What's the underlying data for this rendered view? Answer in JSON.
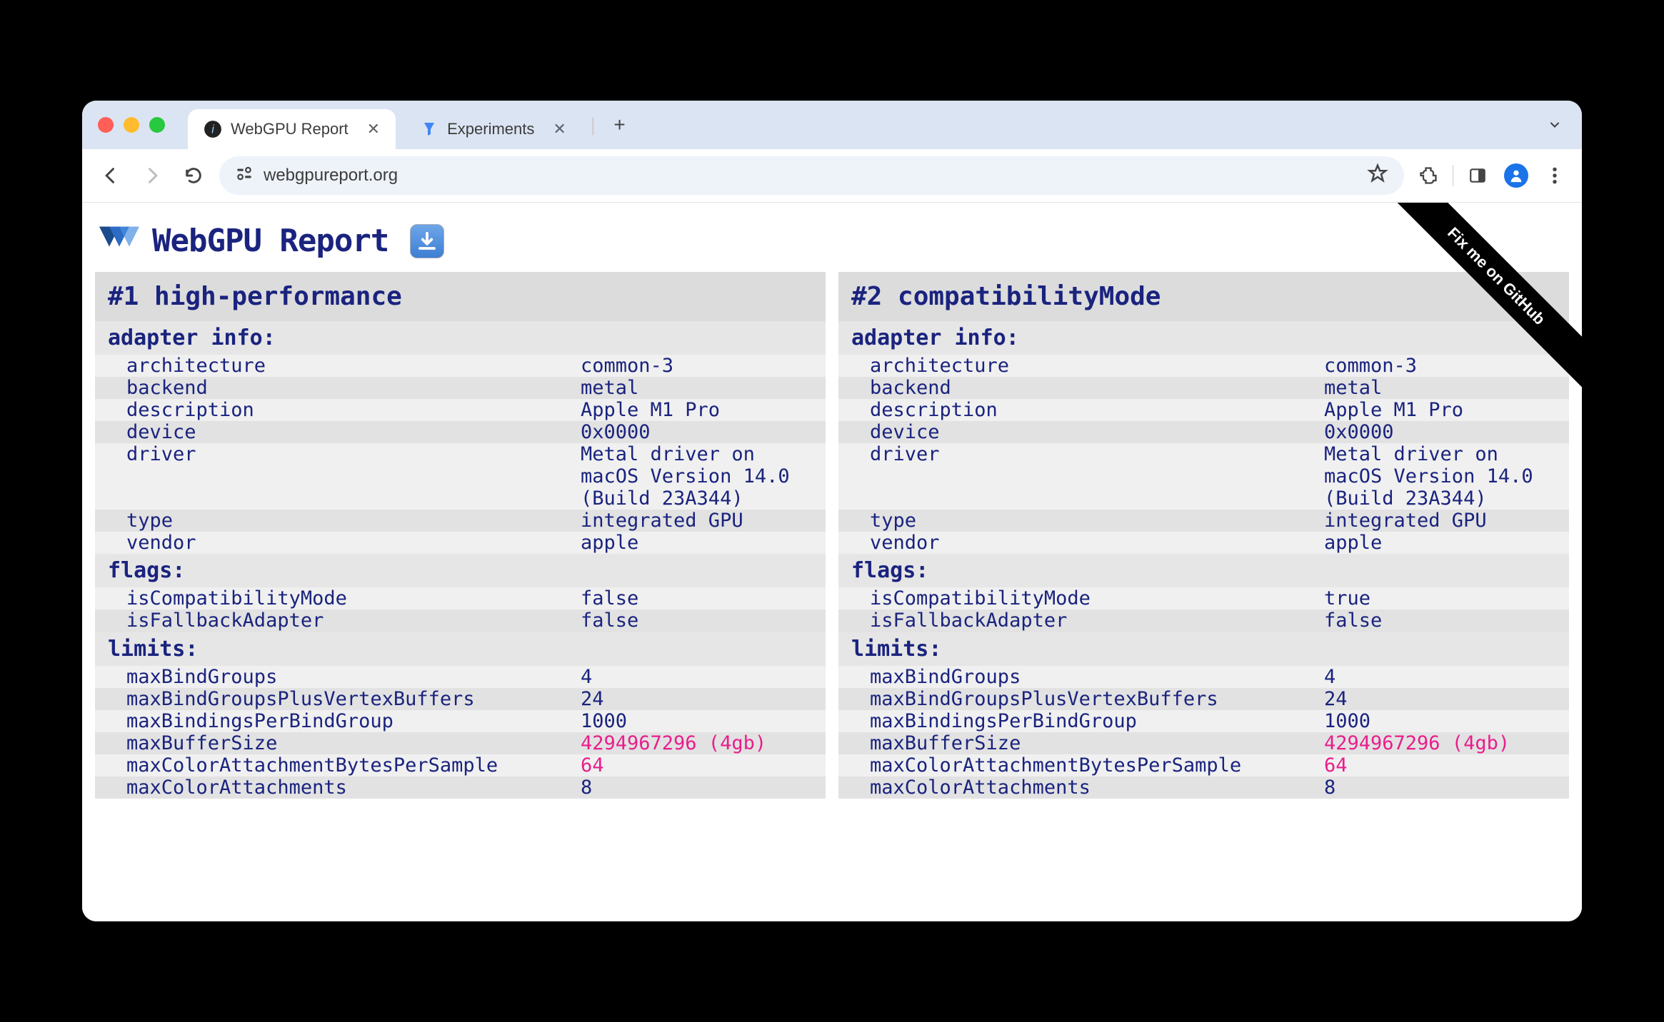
{
  "browser": {
    "tabs": [
      {
        "title": "WebGPU Report",
        "active": true
      },
      {
        "title": "Experiments",
        "active": false
      }
    ],
    "url": "webgpureport.org"
  },
  "page": {
    "title": "WebGPU Report",
    "ribbon": "Fix me on GitHub"
  },
  "adapters": [
    {
      "header": "#1 high-performance",
      "sections": [
        {
          "title": "adapter info:",
          "rows": [
            {
              "k": "architecture",
              "v": "common-3"
            },
            {
              "k": "backend",
              "v": "metal"
            },
            {
              "k": "description",
              "v": "Apple M1 Pro"
            },
            {
              "k": "device",
              "v": "0x0000"
            },
            {
              "k": "driver",
              "v": "Metal driver on macOS Version 14.0 (Build 23A344)"
            },
            {
              "k": "type",
              "v": "integrated GPU"
            },
            {
              "k": "vendor",
              "v": "apple"
            }
          ]
        },
        {
          "title": "flags:",
          "rows": [
            {
              "k": "isCompatibilityMode",
              "v": "false"
            },
            {
              "k": "isFallbackAdapter",
              "v": "false"
            }
          ]
        },
        {
          "title": "limits:",
          "rows": [
            {
              "k": "maxBindGroups",
              "v": "4"
            },
            {
              "k": "maxBindGroupsPlusVertexBuffers",
              "v": "24"
            },
            {
              "k": "maxBindingsPerBindGroup",
              "v": "1000"
            },
            {
              "k": "maxBufferSize",
              "v": "4294967296 (4gb)",
              "diff": true
            },
            {
              "k": "maxColorAttachmentBytesPerSample",
              "v": "64",
              "diff": true
            },
            {
              "k": "maxColorAttachments",
              "v": "8"
            }
          ]
        }
      ]
    },
    {
      "header": "#2 compatibilityMode",
      "sections": [
        {
          "title": "adapter info:",
          "rows": [
            {
              "k": "architecture",
              "v": "common-3"
            },
            {
              "k": "backend",
              "v": "metal"
            },
            {
              "k": "description",
              "v": "Apple M1 Pro"
            },
            {
              "k": "device",
              "v": "0x0000"
            },
            {
              "k": "driver",
              "v": "Metal driver on macOS Version 14.0 (Build 23A344)"
            },
            {
              "k": "type",
              "v": "integrated GPU"
            },
            {
              "k": "vendor",
              "v": "apple"
            }
          ]
        },
        {
          "title": "flags:",
          "rows": [
            {
              "k": "isCompatibilityMode",
              "v": "true"
            },
            {
              "k": "isFallbackAdapter",
              "v": "false"
            }
          ]
        },
        {
          "title": "limits:",
          "rows": [
            {
              "k": "maxBindGroups",
              "v": "4"
            },
            {
              "k": "maxBindGroupsPlusVertexBuffers",
              "v": "24"
            },
            {
              "k": "maxBindingsPerBindGroup",
              "v": "1000"
            },
            {
              "k": "maxBufferSize",
              "v": "4294967296 (4gb)",
              "diff": true
            },
            {
              "k": "maxColorAttachmentBytesPerSample",
              "v": "64",
              "diff": true
            },
            {
              "k": "maxColorAttachments",
              "v": "8"
            }
          ]
        }
      ]
    }
  ]
}
